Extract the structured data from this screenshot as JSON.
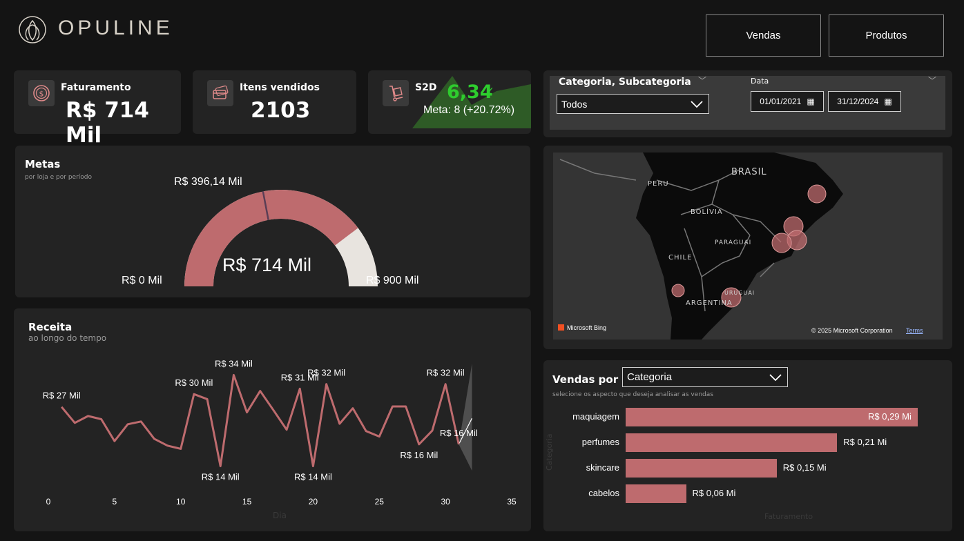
{
  "brand": {
    "name": "OPULINE"
  },
  "nav": {
    "vendas": "Vendas",
    "produtos": "Produtos"
  },
  "kpis": {
    "faturamento": {
      "title": "Faturamento",
      "value": "R$ 714 Mil"
    },
    "itens": {
      "title": "Itens vendidos",
      "value": "2103"
    },
    "s2d": {
      "title": "S2D",
      "value": "6,34",
      "meta": "Meta: 8 (+20.72%)"
    }
  },
  "filters": {
    "categoria": {
      "label": "Categoria, Subcategoria",
      "value": "Todos"
    },
    "data": {
      "label": "Data",
      "start": "01/01/2021",
      "end": "31/12/2024"
    }
  },
  "metas": {
    "title": "Metas",
    "subtitle": "por loja e por período",
    "value": "R$ 714 Mil",
    "min": "R$ 0 Mil",
    "max": "R$ 900 Mil",
    "target": "R$ 396,14 Mil",
    "fraction": 0.7933,
    "target_fraction": 0.4402
  },
  "map": {
    "labels": {
      "brasil": "BRASIL",
      "peru": "PERU",
      "bolivia": "BOLÍVIA",
      "paraguai": "PARAGUAI",
      "chile": "CHILE",
      "argentina": "ARGENTINA",
      "uruguai": "URUGUAI"
    },
    "bing": "Microsoft Bing",
    "copyright": "© 2025 Microsoft Corporation",
    "terms": "Terms"
  },
  "receita": {
    "title": "Receita",
    "subtitle": "ao longo do tempo",
    "xlabel": "Dia"
  },
  "vendas_por": {
    "title": "Vendas por",
    "selector": "Categoria",
    "subtitle": "selecione os aspecto que deseja analisar as vendas",
    "ylabel": "Categoria",
    "xlabel": "Faturamento"
  },
  "chart_data": [
    {
      "type": "line",
      "title": "Receita",
      "xlabel": "Dia",
      "x": [
        1,
        2,
        3,
        4,
        5,
        6,
        7,
        8,
        9,
        10,
        11,
        12,
        13,
        14,
        15,
        16,
        17,
        18,
        19,
        20,
        21,
        22,
        23,
        24,
        25,
        26,
        27,
        28,
        29,
        30,
        31
      ],
      "xticks": [
        0,
        5,
        10,
        15,
        20,
        25,
        30,
        35
      ],
      "xlim": [
        0,
        35
      ],
      "ylim": [
        10,
        38
      ],
      "values": [
        27,
        23.5,
        25,
        24.3,
        19.5,
        23.2,
        23.8,
        20,
        18.5,
        17.8,
        29.8,
        28.7,
        14,
        34,
        25.8,
        30.5,
        26.3,
        22,
        31,
        14,
        32,
        23.3,
        26.7,
        21.7,
        20.5,
        27.1,
        27.1,
        18.8,
        21.8,
        32,
        18.8
      ],
      "data_labels": [
        {
          "x": 1,
          "text": "R$ 27 Mil"
        },
        {
          "x": 11,
          "text": "R$ 30 Mil"
        },
        {
          "x": 13,
          "text": "R$ 14 Mil"
        },
        {
          "x": 14,
          "text": "R$ 34 Mil"
        },
        {
          "x": 19,
          "text": "R$ 31 Mil"
        },
        {
          "x": 20,
          "text": "R$ 14 Mil"
        },
        {
          "x": 21,
          "text": "R$ 32 Mil"
        },
        {
          "x": 28,
          "text": "R$ 16 Mil"
        },
        {
          "x": 30,
          "text": "R$ 32 Mil"
        },
        {
          "x": 31,
          "text": "R$ 16 Mil"
        }
      ],
      "color": "#be6b6e"
    },
    {
      "type": "bar",
      "title": "Vendas por",
      "orientation": "horizontal",
      "categories": [
        "maquiagem",
        "perfumes",
        "skincare",
        "cabelos"
      ],
      "values": [
        0.29,
        0.21,
        0.15,
        0.06
      ],
      "value_labels": [
        "R$ 0,29 Mi",
        "R$ 0,21 Mi",
        "R$ 0,15 Mi",
        "R$ 0,06 Mi"
      ],
      "xlabel": "Faturamento",
      "ylabel": "Categoria",
      "color": "#be6b6e"
    }
  ],
  "colors": {
    "accent": "#be6b6e",
    "gauge_rest": "#e8e4df",
    "s2d_green": "#2ecc2e",
    "card": "#232323"
  }
}
